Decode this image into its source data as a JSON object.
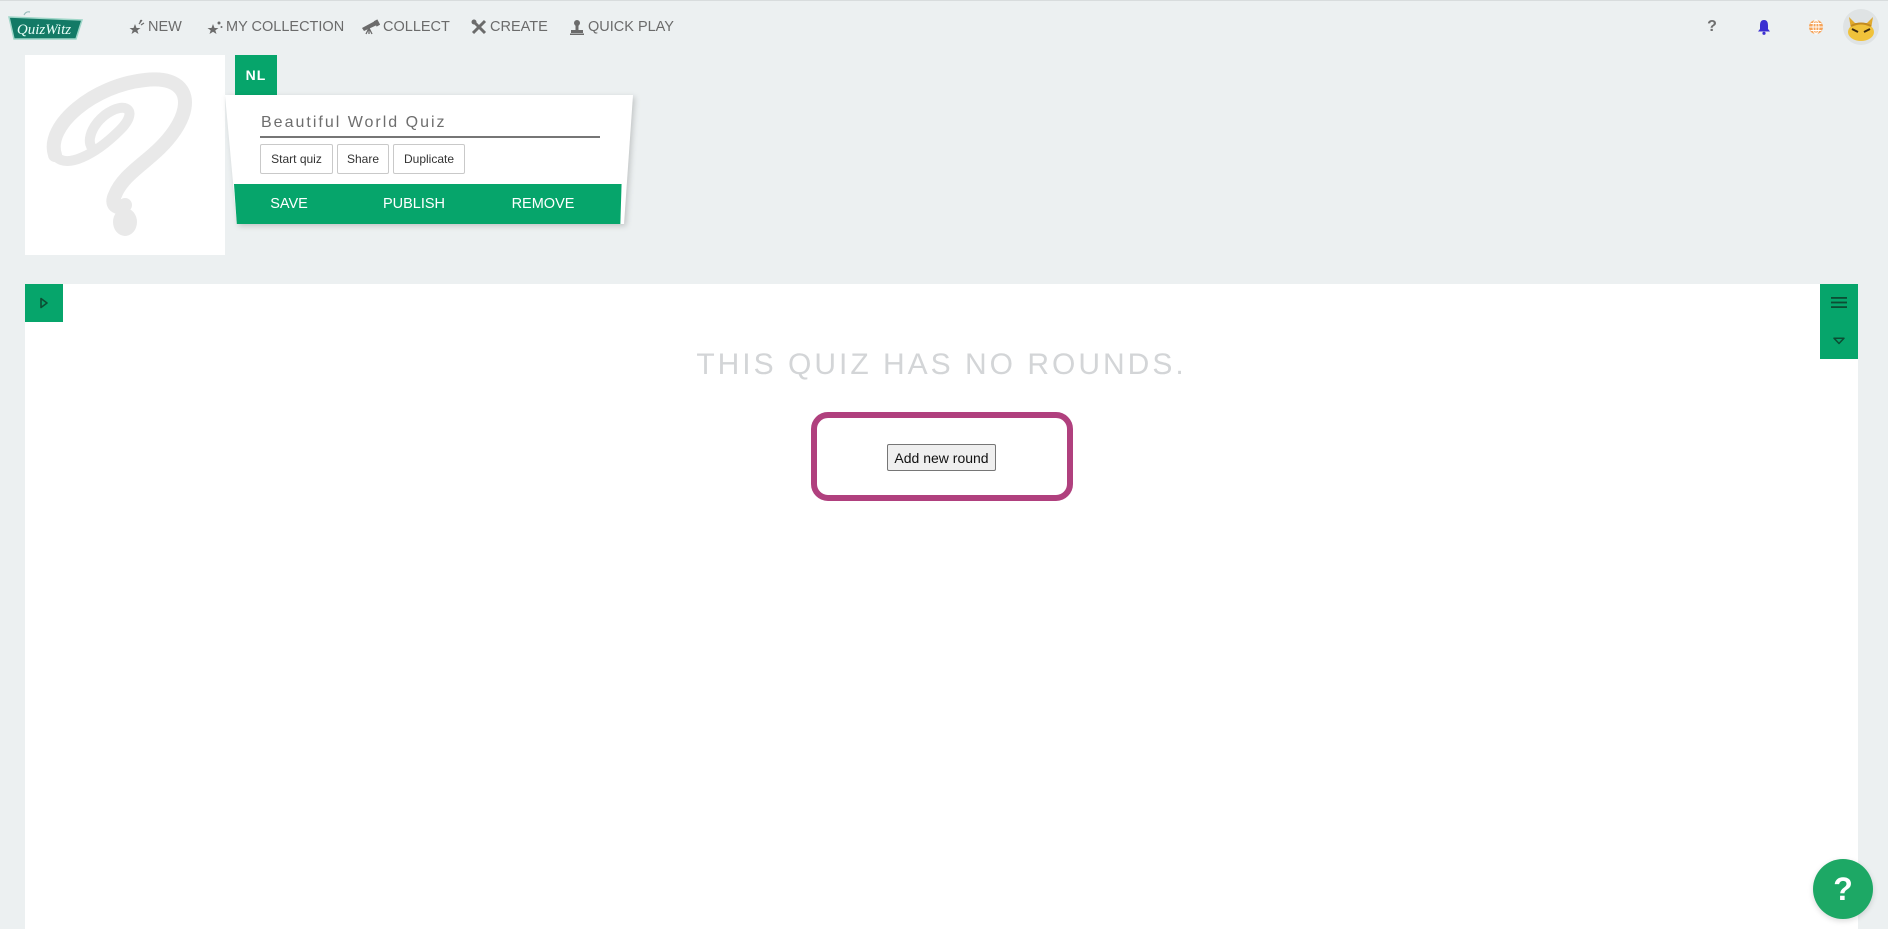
{
  "app": {
    "logo_text": "QuizWitz"
  },
  "nav": {
    "items": [
      {
        "label": "NEW",
        "icon": "new-star-icon"
      },
      {
        "label": "MY COLLECTION",
        "icon": "collection-star-icon"
      },
      {
        "label": "COLLECT",
        "icon": "telescope-icon"
      },
      {
        "label": "CREATE",
        "icon": "tools-icon"
      },
      {
        "label": "QUICK PLAY",
        "icon": "stamp-icon"
      }
    ],
    "right_icons": [
      "help-icon",
      "bell-icon",
      "globe-icon",
      "avatar"
    ]
  },
  "quiz": {
    "language": "NL",
    "title": "Beautiful World Quiz",
    "buttons": {
      "start": "Start quiz",
      "share": "Share",
      "duplicate": "Duplicate"
    },
    "actions": {
      "save": "SAVE",
      "publish": "PUBLISH",
      "remove": "REMOVE"
    }
  },
  "main": {
    "empty_message": "THIS QUIZ HAS NO ROUNDS.",
    "add_round_label": "Add new round"
  },
  "help_fab": {
    "label": "?"
  },
  "colors": {
    "brand_green": "#06a56b",
    "highlight": "#b0407e",
    "bell": "#3b2fd1",
    "globe": "#f6a45a"
  }
}
